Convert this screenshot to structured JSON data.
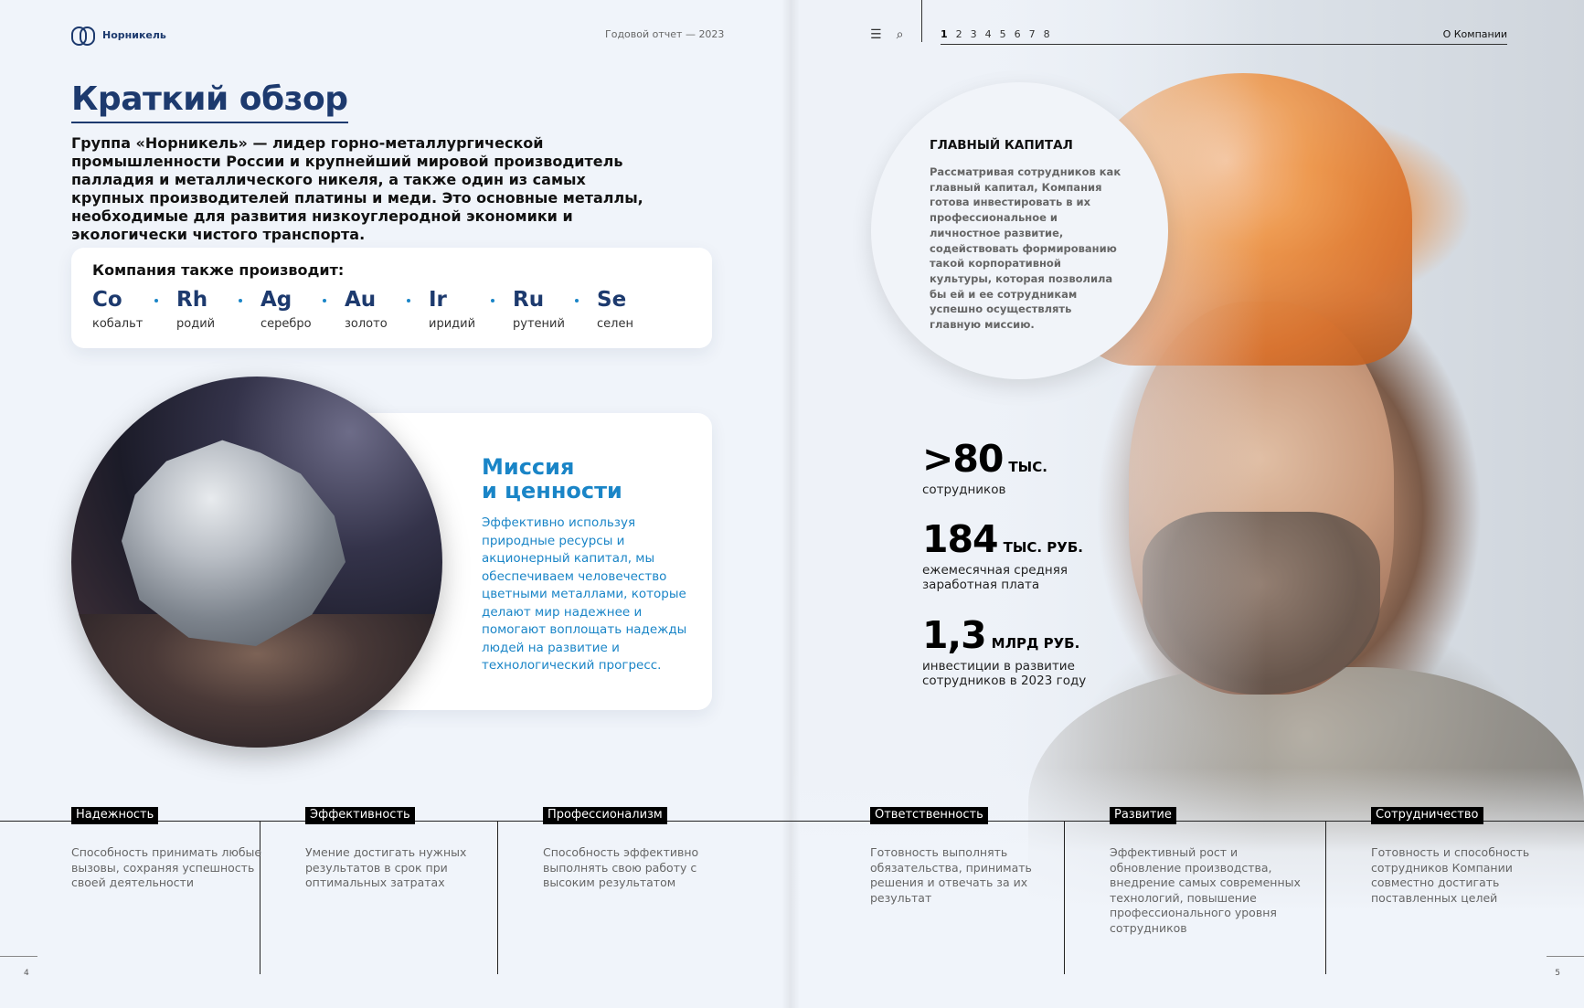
{
  "left": {
    "logo_text": "Норникель",
    "report_title": "Годовой отчет — 2023",
    "title": "Краткий обзор",
    "intro": "Группа «Норникель» — лидер горно-металлургической промышленности России и крупнейший мировой производитель палладия и металлического никеля, а также один из самых крупных производителей платины и меди. Это основные металлы, необходимые для развития низкоуглеродной экономики и экологически чистого транспорта.",
    "produces_title": "Компания также производит:",
    "elements": [
      {
        "symbol": "Co",
        "name": "кобальт"
      },
      {
        "symbol": "Rh",
        "name": "родий"
      },
      {
        "symbol": "Ag",
        "name": "серебро"
      },
      {
        "symbol": "Au",
        "name": "золото"
      },
      {
        "symbol": "Ir",
        "name": "иридий"
      },
      {
        "symbol": "Ru",
        "name": "рутений"
      },
      {
        "symbol": "Se",
        "name": "селен"
      }
    ],
    "mission_title_1": "Миссия",
    "mission_title_2": "и ценности",
    "mission_text": "Эффективно используя природные ресурсы и акционерный капитал, мы обеспечиваем человечество цветными металлами, которые делают мир надежнее и помогают воплощать надежды людей на развитие и технологический прогресс.",
    "page_number": "4"
  },
  "right": {
    "nav_pages": [
      "1",
      "2",
      "3",
      "4",
      "5",
      "6",
      "7",
      "8"
    ],
    "active_page": "1",
    "section": "О Компании",
    "capital_title": "ГЛАВНЫЙ КАПИТАЛ",
    "capital_text": "Рассматривая сотрудников как главный капитал, Компания готова инвестировать в их профессиональное и личностное развитие, содействовать формированию такой корпоративной культуры, которая позволила бы ей и ее сотрудникам успешно осуществлять главную миссию.",
    "stats": [
      {
        "value": ">80",
        "unit": "ТЫС.",
        "label": "сотрудников"
      },
      {
        "value": "184",
        "unit": "ТЫС. РУБ.",
        "label": "ежемесячная средняя заработная плата"
      },
      {
        "value": "1,3",
        "unit": "МЛРД РУБ.",
        "label": "инвестиции в развитие сотрудников в 2023 году"
      }
    ],
    "page_number": "5"
  },
  "values": [
    {
      "tag": "Надежность",
      "desc": "Способность принимать любые вызовы, сохраняя успешность своей деятельности"
    },
    {
      "tag": "Эффективность",
      "desc": "Умение достигать нужных результатов в срок при оптимальных затратах"
    },
    {
      "tag": "Профессионализм",
      "desc": "Способность эффективно выполнять свою работу с высоким результатом"
    },
    {
      "tag": "Ответственность",
      "desc": "Готовность выполнять обязательства, принимать решения и отвечать за их результат"
    },
    {
      "tag": "Развитие",
      "desc": "Эффективный рост и обновление производства, внедрение самых современных технологий, повышение профессионального уровня сотрудников"
    },
    {
      "tag": "Сотрудничество",
      "desc": "Готовность и способность сотрудников Компании совместно достигать поставленных целей"
    }
  ]
}
